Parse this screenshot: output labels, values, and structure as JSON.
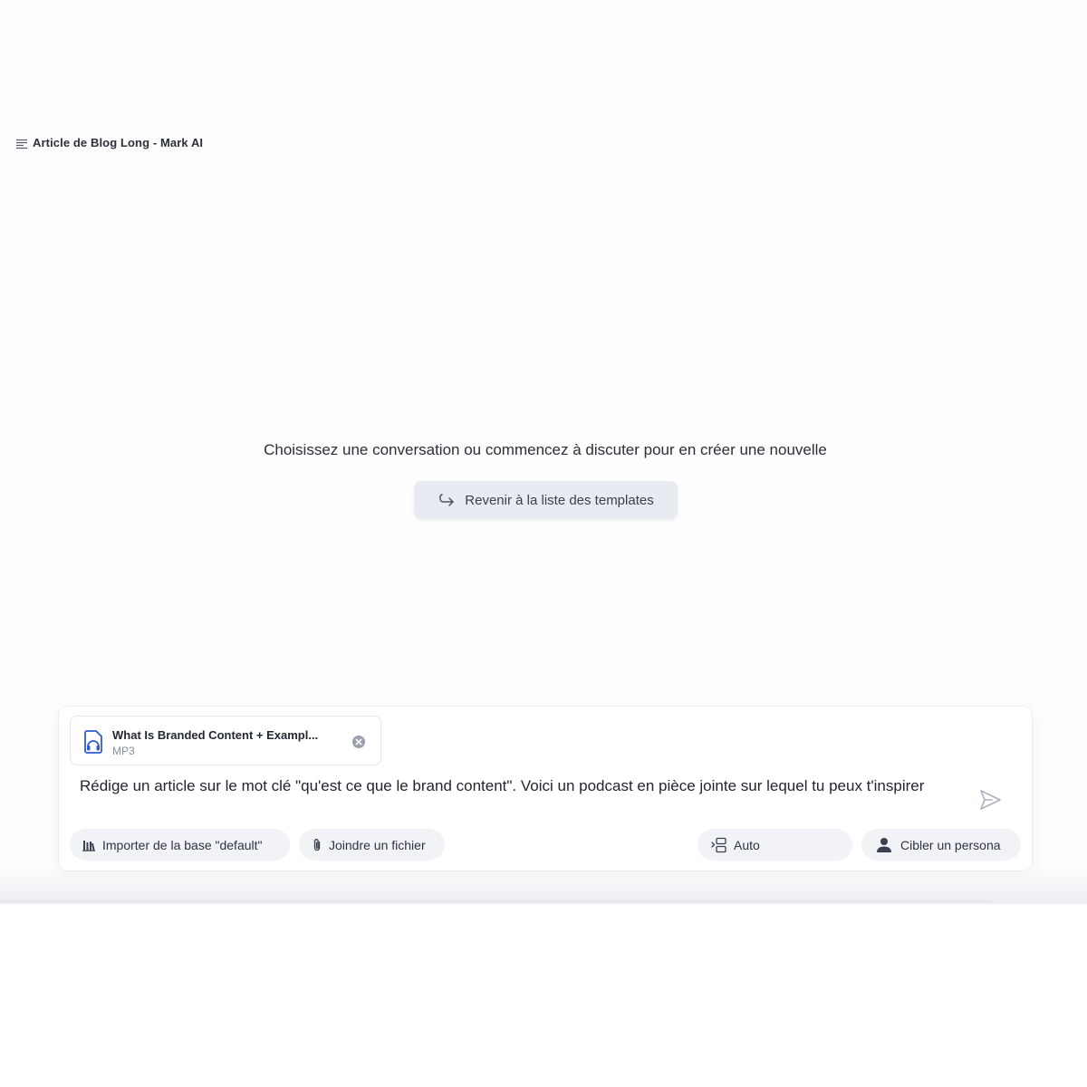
{
  "header": {
    "title": "Article de Blog Long - Mark AI",
    "menu_icon": "menu-lines-icon"
  },
  "empty_state": {
    "message": "Choisissez une conversation ou commencez à discuter pour en créer une nouvelle",
    "back_button_label": "Revenir à la liste des templates",
    "back_button_icon": "return-arrow-icon"
  },
  "composer": {
    "attachment": {
      "name": "What Is Branded Content + Exampl...",
      "type": "MP3",
      "icon": "audio-file-icon",
      "remove_icon": "remove-circle-icon"
    },
    "prompt_text": "Rédige un article sur le mot clé \"qu'est ce que le brand content\". Voici un podcast en pièce jointe sur lequel tu peux t'inspirer",
    "send_icon": "send-icon",
    "actions": {
      "import_label": "Importer de la base \"default\"",
      "join_label": "Joindre un fichier",
      "auto_label": "Auto",
      "persona_label": "Cibler un persona"
    }
  },
  "colors": {
    "accent": "#2f5bd3",
    "button_bg": "#e8ebf2",
    "chip_bg": "#f1f3f7"
  }
}
